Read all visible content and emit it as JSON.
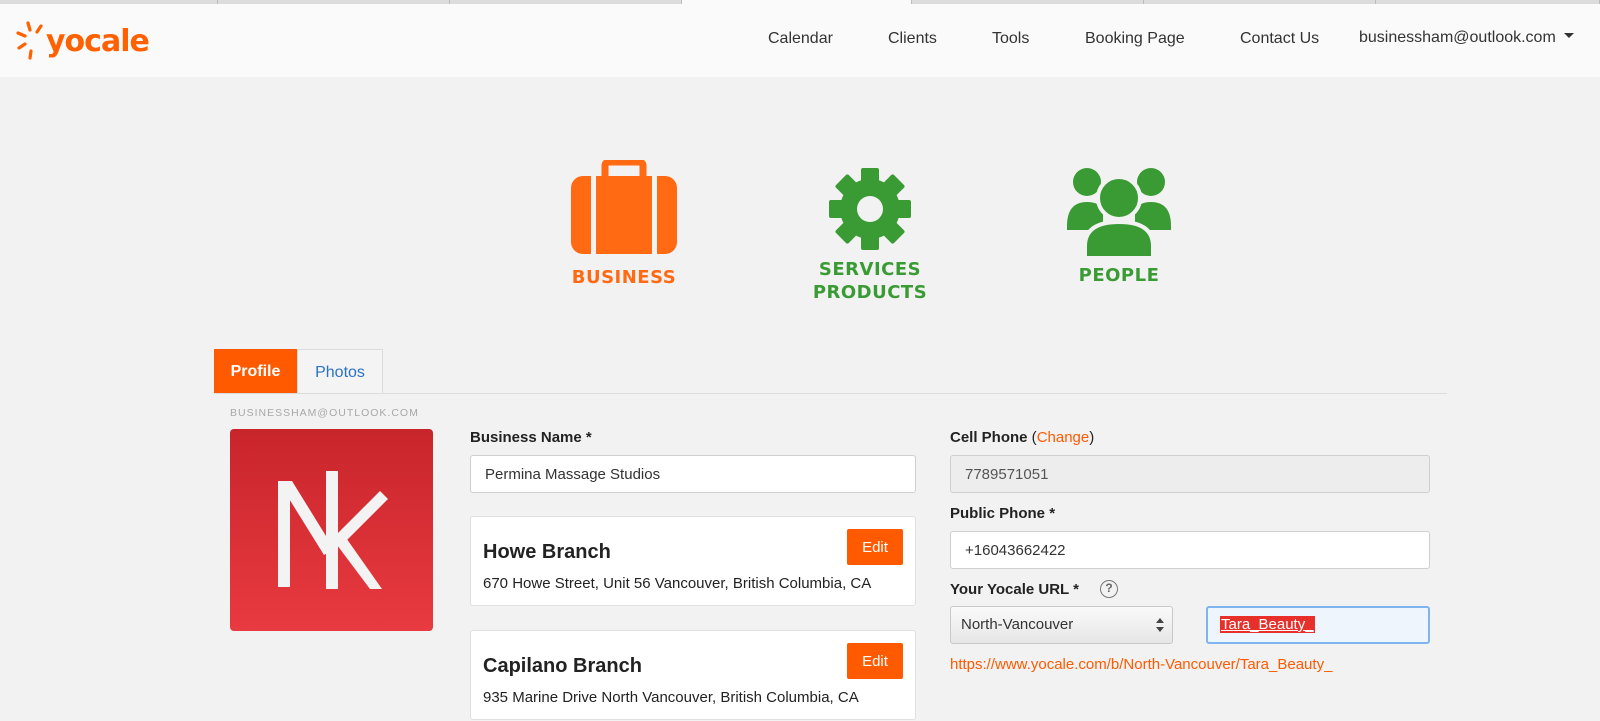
{
  "brand": {
    "logo_text": "yocale",
    "accent": "#ff5a00",
    "green": "#3a9b35"
  },
  "nav": {
    "items": [
      {
        "label": "Calendar"
      },
      {
        "label": "Clients"
      },
      {
        "label": "Tools"
      },
      {
        "label": "Booking Page"
      },
      {
        "label": "Contact Us"
      }
    ],
    "account": "businessham@outlook.com"
  },
  "hero": {
    "business": "BUSINESS",
    "services_line1": "SERVICES",
    "services_line2": "PRODUCTS",
    "people": "PEOPLE"
  },
  "tabs": {
    "profile": "Profile",
    "photos": "Photos"
  },
  "profile": {
    "email_caption": "BUSINESSHAM@OUTLOOK.COM",
    "avatar_letters": "NK"
  },
  "form": {
    "business_name_label": "Business Name",
    "required_mark": "*",
    "business_name_value": "Permina Massage Studios",
    "cell_phone_label": "Cell Phone",
    "change_link": "Change",
    "cell_phone_value": "7789571051",
    "public_phone_label": "Public Phone",
    "public_phone_value": "+16043662422",
    "yocale_url_label": "Your Yocale URL",
    "help_symbol": "?",
    "city_selected": "North-Vancouver",
    "slug_value": "Tara_Beauty_",
    "url_preview": "https://www.yocale.com/b/North-Vancouver/Tara_Beauty_"
  },
  "branches": [
    {
      "name": "Howe Branch",
      "address": "670 Howe Street, Unit 56 Vancouver, British Columbia, CA",
      "edit_label": "Edit"
    },
    {
      "name": "Capilano Branch",
      "address": "935 Marine Drive North Vancouver, British Columbia, CA",
      "edit_label": "Edit"
    }
  ]
}
